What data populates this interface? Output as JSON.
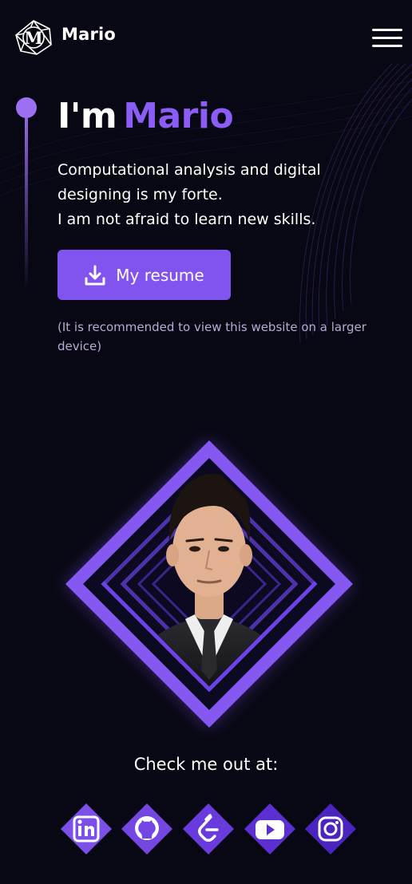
{
  "header": {
    "brand": "Mario",
    "logo_letter": "M"
  },
  "hero": {
    "title_prefix": "I'm",
    "title_name": "Mario",
    "tagline_lines": [
      "Computational analysis and digital",
      "designing is my forte.",
      "I am not afraid to learn new skills."
    ],
    "resume_label": "My resume",
    "note": "(It is recommended to view this website on a larger device)"
  },
  "contact": {
    "heading": "Check me out at:",
    "links": [
      {
        "name": "linkedin-icon",
        "color": "#7c4fe8"
      },
      {
        "name": "github-icon",
        "color": "#7446e2"
      },
      {
        "name": "leetcode-icon",
        "color": "#6a3bdc"
      },
      {
        "name": "youtube-icon",
        "color": "#5b2fd0"
      },
      {
        "name": "instagram-icon",
        "color": "#4b24bf"
      }
    ]
  },
  "colors": {
    "accent": "#8b5cf6",
    "background": "#080814",
    "button": "#8254ef"
  }
}
